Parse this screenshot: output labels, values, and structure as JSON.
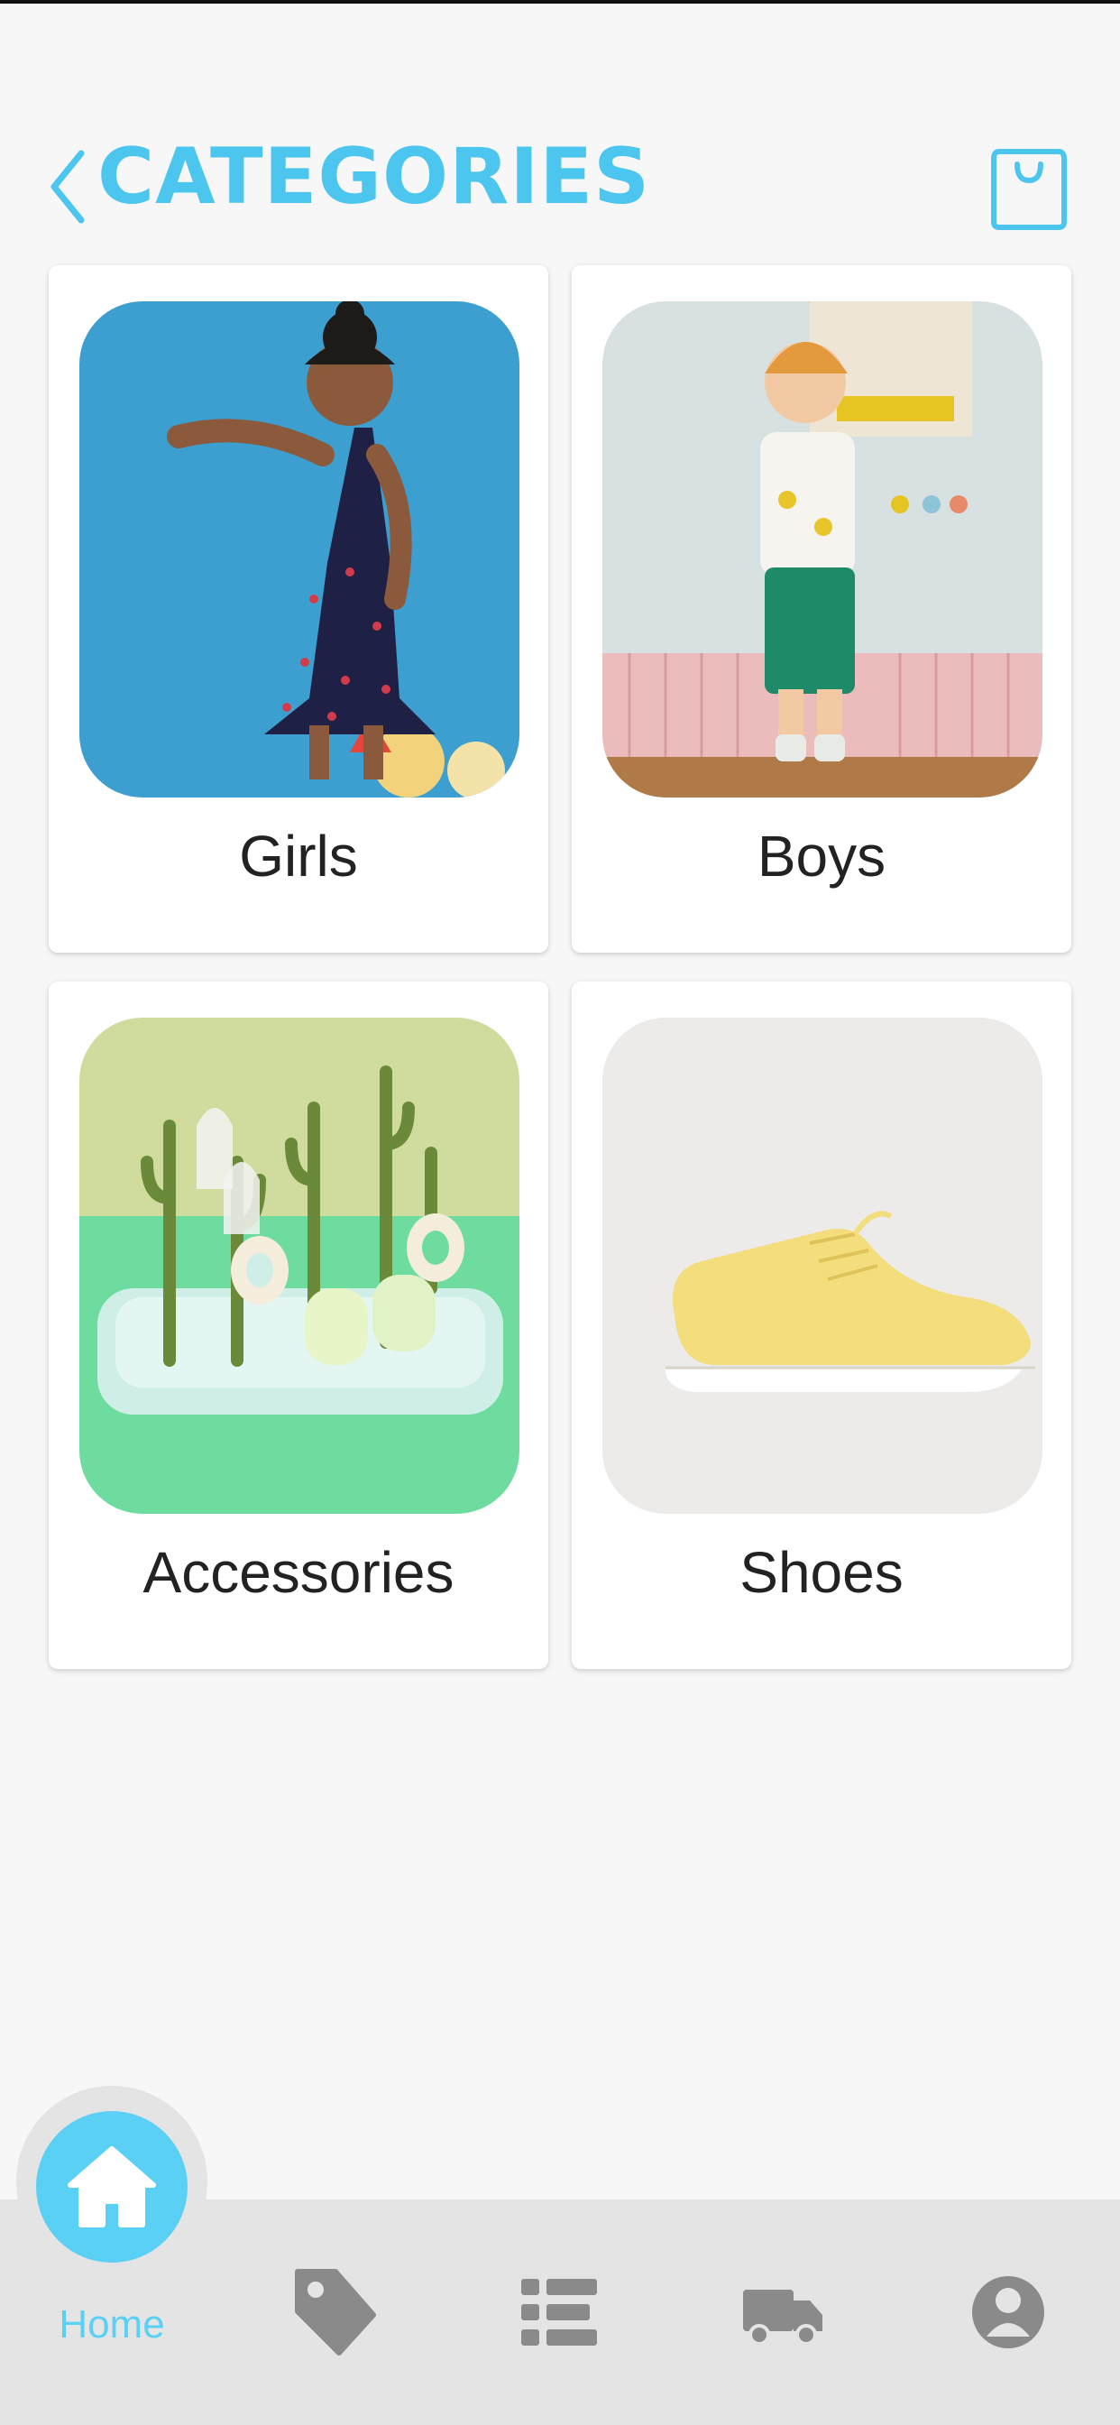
{
  "header": {
    "title": "CATEGORIES",
    "accent_color": "#4cc6ef",
    "back_icon": "chevron-left-icon",
    "cart_icon": "shopping-bag-icon"
  },
  "categories": [
    {
      "label": "Girls",
      "image": "girl in navy cherry dress on blue background"
    },
    {
      "label": "Boys",
      "image": "boy in white tee and green shorts"
    },
    {
      "label": "Accessories",
      "image": "cactus bottle drying rack"
    },
    {
      "label": "Shoes",
      "image": "yellow knit sneaker"
    }
  ],
  "bottom_nav": {
    "items": [
      {
        "label": "Home",
        "icon": "home-icon",
        "active": true
      },
      {
        "label": "",
        "icon": "tag-icon"
      },
      {
        "label": "",
        "icon": "list-icon"
      },
      {
        "label": "",
        "icon": "truck-icon"
      },
      {
        "label": "",
        "icon": "user-icon"
      }
    ],
    "active_color": "#5bd0f5",
    "inactive_color": "#8a8a8a"
  }
}
